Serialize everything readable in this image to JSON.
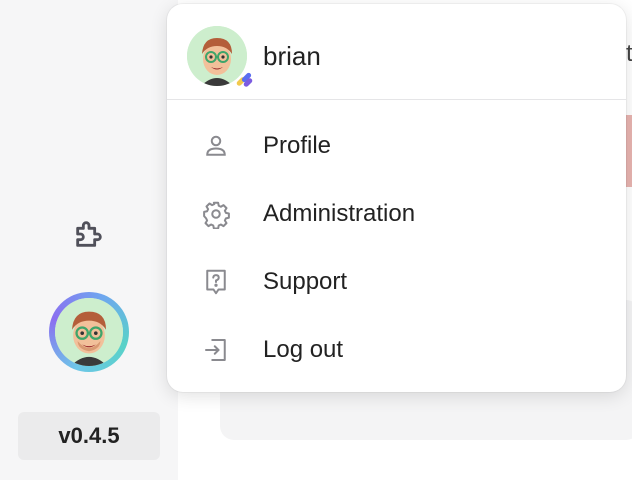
{
  "sidebar": {
    "plugin_icon": "puzzle-icon",
    "avatar_icon": "memoji-avatar",
    "version": "v0.4.5"
  },
  "background": {
    "partial_text": "t"
  },
  "user_menu": {
    "username": "brian",
    "avatar_icon": "memoji-avatar",
    "badge_icon": "status-badge",
    "items": [
      {
        "label": "Profile",
        "icon": "user-icon"
      },
      {
        "label": "Administration",
        "icon": "gear-icon"
      },
      {
        "label": "Support",
        "icon": "help-icon"
      },
      {
        "label": "Log out",
        "icon": "logout-icon"
      }
    ]
  },
  "colors": {
    "menu_icon": "#8a8a8f",
    "avatar_bg": "#cdeecd",
    "ring_start": "#6ec6e8",
    "ring_mid": "#8b6ff0"
  }
}
